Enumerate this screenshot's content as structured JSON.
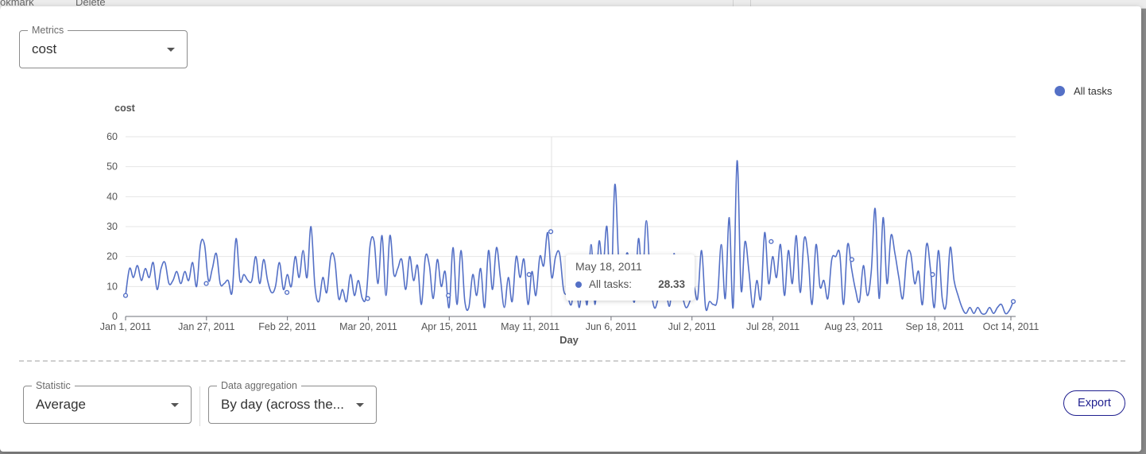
{
  "background": {
    "text_left": "okmark",
    "text_delete": "Delete"
  },
  "metrics_select": {
    "label": "Metrics",
    "value": "cost"
  },
  "statistic_select": {
    "label": "Statistic",
    "value": "Average"
  },
  "aggregation_select": {
    "label": "Data aggregation",
    "value": "By day (across the..."
  },
  "export_label": "Export",
  "tooltip": {
    "date": "May 18, 2011",
    "series": "All tasks:",
    "value": "28.33"
  },
  "colors": {
    "series": "#5470c6",
    "accent": "#1f1f8f"
  },
  "chart_data": {
    "type": "line",
    "ylabel": "cost",
    "xlabel": "Day",
    "ylim": [
      0,
      60
    ],
    "y_ticks": [
      0,
      10,
      20,
      30,
      40,
      50,
      60
    ],
    "x_ticks": [
      "Jan 1, 2011",
      "Jan 27, 2011",
      "Feb 22, 2011",
      "Mar 20, 2011",
      "Apr 15, 2011",
      "May 11, 2011",
      "Jun 6, 2011",
      "Jul 2, 2011",
      "Jul 28, 2011",
      "Aug 23, 2011",
      "Sep 18, 2011",
      "Oct 14, 2011"
    ],
    "grid": true,
    "legend": "top-right",
    "series": [
      {
        "name": "All tasks",
        "x_start": "Jan 1, 2011",
        "x_end": "Oct 14, 2011",
        "values": [
          7,
          16,
          13,
          17,
          12,
          16,
          13,
          18,
          9,
          16,
          18,
          11,
          12,
          15,
          11,
          15,
          12,
          18,
          10,
          24,
          24,
          12,
          16,
          21,
          11,
          11,
          12,
          8,
          26,
          12,
          14,
          12,
          12,
          20,
          11,
          19,
          12,
          8,
          10,
          18,
          9,
          14,
          10,
          20,
          13,
          22,
          13,
          30,
          10,
          5,
          13,
          8,
          20,
          19,
          6,
          9,
          5,
          14,
          7,
          12,
          6,
          7,
          24,
          25,
          11,
          27,
          7,
          27,
          14,
          16,
          19,
          9,
          20,
          12,
          17,
          4,
          20,
          17,
          6,
          19,
          10,
          15,
          3,
          23,
          4,
          22,
          5,
          3,
          14,
          7,
          16,
          3,
          22,
          9,
          23,
          13,
          3,
          13,
          5,
          20,
          13,
          19,
          4,
          15,
          7,
          20,
          17,
          28,
          13,
          20,
          21,
          9,
          7,
          4,
          13,
          3,
          14,
          4,
          24,
          4,
          25,
          16,
          30,
          6,
          44,
          18,
          7,
          21,
          15,
          5,
          26,
          12,
          32,
          12,
          3,
          6,
          11,
          8,
          4,
          21,
          7,
          7,
          3,
          5,
          10,
          6,
          22,
          3,
          5,
          4,
          6,
          24,
          6,
          33,
          3,
          52,
          9,
          25,
          15,
          3,
          12,
          6,
          28,
          11,
          20,
          13,
          24,
          7,
          22,
          11,
          27,
          8,
          26,
          20,
          4,
          24,
          10,
          12,
          6,
          19,
          20,
          21,
          4,
          24,
          16,
          9,
          5,
          17,
          7,
          15,
          36,
          6,
          33,
          11,
          27,
          21,
          13,
          6,
          20,
          21,
          11,
          15,
          4,
          24,
          16,
          3,
          22,
          6,
          4,
          23,
          12,
          7,
          3,
          1,
          3,
          1,
          3,
          1,
          1,
          3,
          1,
          3,
          4,
          1,
          2,
          5
        ]
      }
    ],
    "markers": [
      {
        "x": "Jan 1, 2011",
        "y": 7
      },
      {
        "x": "Jan 27, 2011",
        "y": 11
      },
      {
        "x": "Feb 22, 2011",
        "y": 8
      },
      {
        "x": "Mar 20, 2011",
        "y": 6
      },
      {
        "x": "Apr 15, 2011",
        "y": 7
      },
      {
        "x": "May 11, 2011",
        "y": 14
      },
      {
        "x": "May 18, 2011",
        "y": 28.33
      },
      {
        "x": "Jul 28, 2011",
        "y": 25
      },
      {
        "x": "Aug 23, 2011",
        "y": 19
      },
      {
        "x": "Sep 18, 2011",
        "y": 14
      },
      {
        "x": "Oct 14, 2011",
        "y": 5
      }
    ]
  }
}
